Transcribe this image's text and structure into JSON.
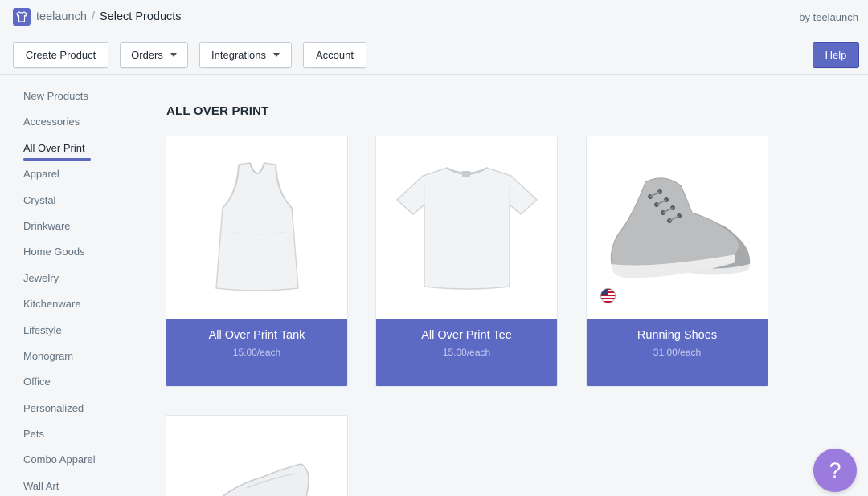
{
  "header": {
    "app_name": "teelaunch",
    "separator": "/",
    "page_title": "Select Products",
    "by_label": "by teelaunch"
  },
  "toolbar": {
    "create_product": "Create Product",
    "orders": "Orders",
    "integrations": "Integrations",
    "account": "Account",
    "help": "Help"
  },
  "sidebar": {
    "items": [
      {
        "label": "New Products"
      },
      {
        "label": "Accessories"
      },
      {
        "label": "All Over Print",
        "active": true
      },
      {
        "label": "Apparel"
      },
      {
        "label": "Crystal"
      },
      {
        "label": "Drinkware"
      },
      {
        "label": "Home Goods"
      },
      {
        "label": "Jewelry"
      },
      {
        "label": "Kitchenware"
      },
      {
        "label": "Lifestyle"
      },
      {
        "label": "Monogram"
      },
      {
        "label": "Office"
      },
      {
        "label": "Personalized"
      },
      {
        "label": "Pets"
      },
      {
        "label": "Combo Apparel"
      },
      {
        "label": "Wall Art"
      }
    ]
  },
  "main": {
    "section_title": "ALL OVER PRINT",
    "products": [
      {
        "name": "All Over Print Tank",
        "price": "15.00/each",
        "icon": "tank-top-image"
      },
      {
        "name": "All Over Print Tee",
        "price": "15.00/each",
        "icon": "t-shirt-image"
      },
      {
        "name": "Running Shoes",
        "price": "31.00/each",
        "icon": "running-shoe-image",
        "badge": "us-flag-icon"
      },
      {
        "name": "",
        "price": "",
        "icon": "slip-on-shoe-image"
      }
    ]
  },
  "help_fab": {
    "label": "?"
  },
  "colors": {
    "accent": "#5c6ac4",
    "fab": "#9b7bde",
    "background": "#f4f6f8"
  }
}
